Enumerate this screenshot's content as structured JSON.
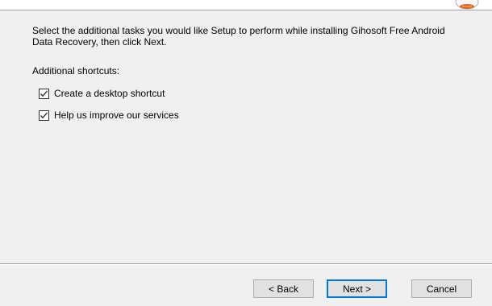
{
  "header": {
    "logo_icon": "installer-logo-icon"
  },
  "main": {
    "description": "Select the additional tasks you would like Setup to perform while installing Gihosoft Free Android Data Recovery, then click Next.",
    "section_label": "Additional shortcuts:",
    "tasks": [
      {
        "label": "Create a desktop shortcut",
        "checked": true
      },
      {
        "label": "Help us improve our services",
        "checked": true
      }
    ]
  },
  "footer": {
    "back_label": "< Back",
    "next_label": "Next >",
    "cancel_label": "Cancel"
  },
  "colors": {
    "panel_bg": "#f0f0f0",
    "default_button_border": "#0078d7"
  }
}
